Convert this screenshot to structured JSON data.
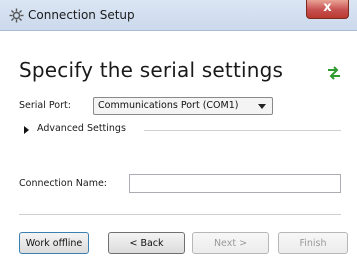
{
  "window": {
    "title": "Connection Setup",
    "close_label": "x"
  },
  "page": {
    "heading": "Specify the serial settings"
  },
  "serial_port": {
    "label": "Serial Port:",
    "selected": "Communications Port (COM1)"
  },
  "advanced": {
    "label": "Advanced Settings"
  },
  "connection_name": {
    "label": "Connection Name:",
    "value": ""
  },
  "buttons": {
    "work_offline": "Work offline",
    "back": "< Back",
    "next": "Next >",
    "finish": "Finish"
  },
  "icons": {
    "app": "network-gear-icon",
    "swap": "swap-arrows-icon"
  },
  "colors": {
    "swap_icon": "#2e9b2e",
    "close_button": "#c75050"
  }
}
